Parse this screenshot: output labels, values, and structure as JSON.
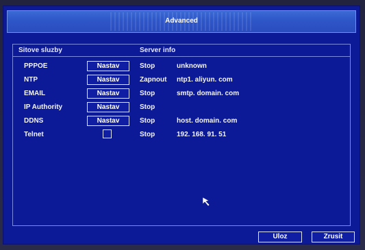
{
  "window": {
    "title": "Advanced"
  },
  "table": {
    "header": {
      "services": "Sitove sluzby",
      "info": "Server info"
    },
    "rows": [
      {
        "name": "PPPOE",
        "action": "Nastav",
        "status": "Stop",
        "info": "unknown"
      },
      {
        "name": "NTP",
        "action": "Nastav",
        "status": "Zapnout",
        "info": "ntp1. aliyun. com"
      },
      {
        "name": "EMAIL",
        "action": "Nastav",
        "status": "Stop",
        "info": "smtp. domain. com"
      },
      {
        "name": "IP Authority",
        "action": "Nastav",
        "status": "Stop",
        "info": ""
      },
      {
        "name": "DDNS",
        "action": "Nastav",
        "status": "Stop",
        "info": "host. domain. com"
      },
      {
        "name": "Telnet",
        "checked": false,
        "status": "Stop",
        "info": "192. 168. 91. 51"
      }
    ]
  },
  "footer": {
    "save_label": "Uloz",
    "cancel_label": "Zrusit"
  },
  "colors": {
    "screen": "#0d1a98",
    "title_bar": "#2e56c8",
    "border": "#7b8be0",
    "text": "#ffffff"
  }
}
